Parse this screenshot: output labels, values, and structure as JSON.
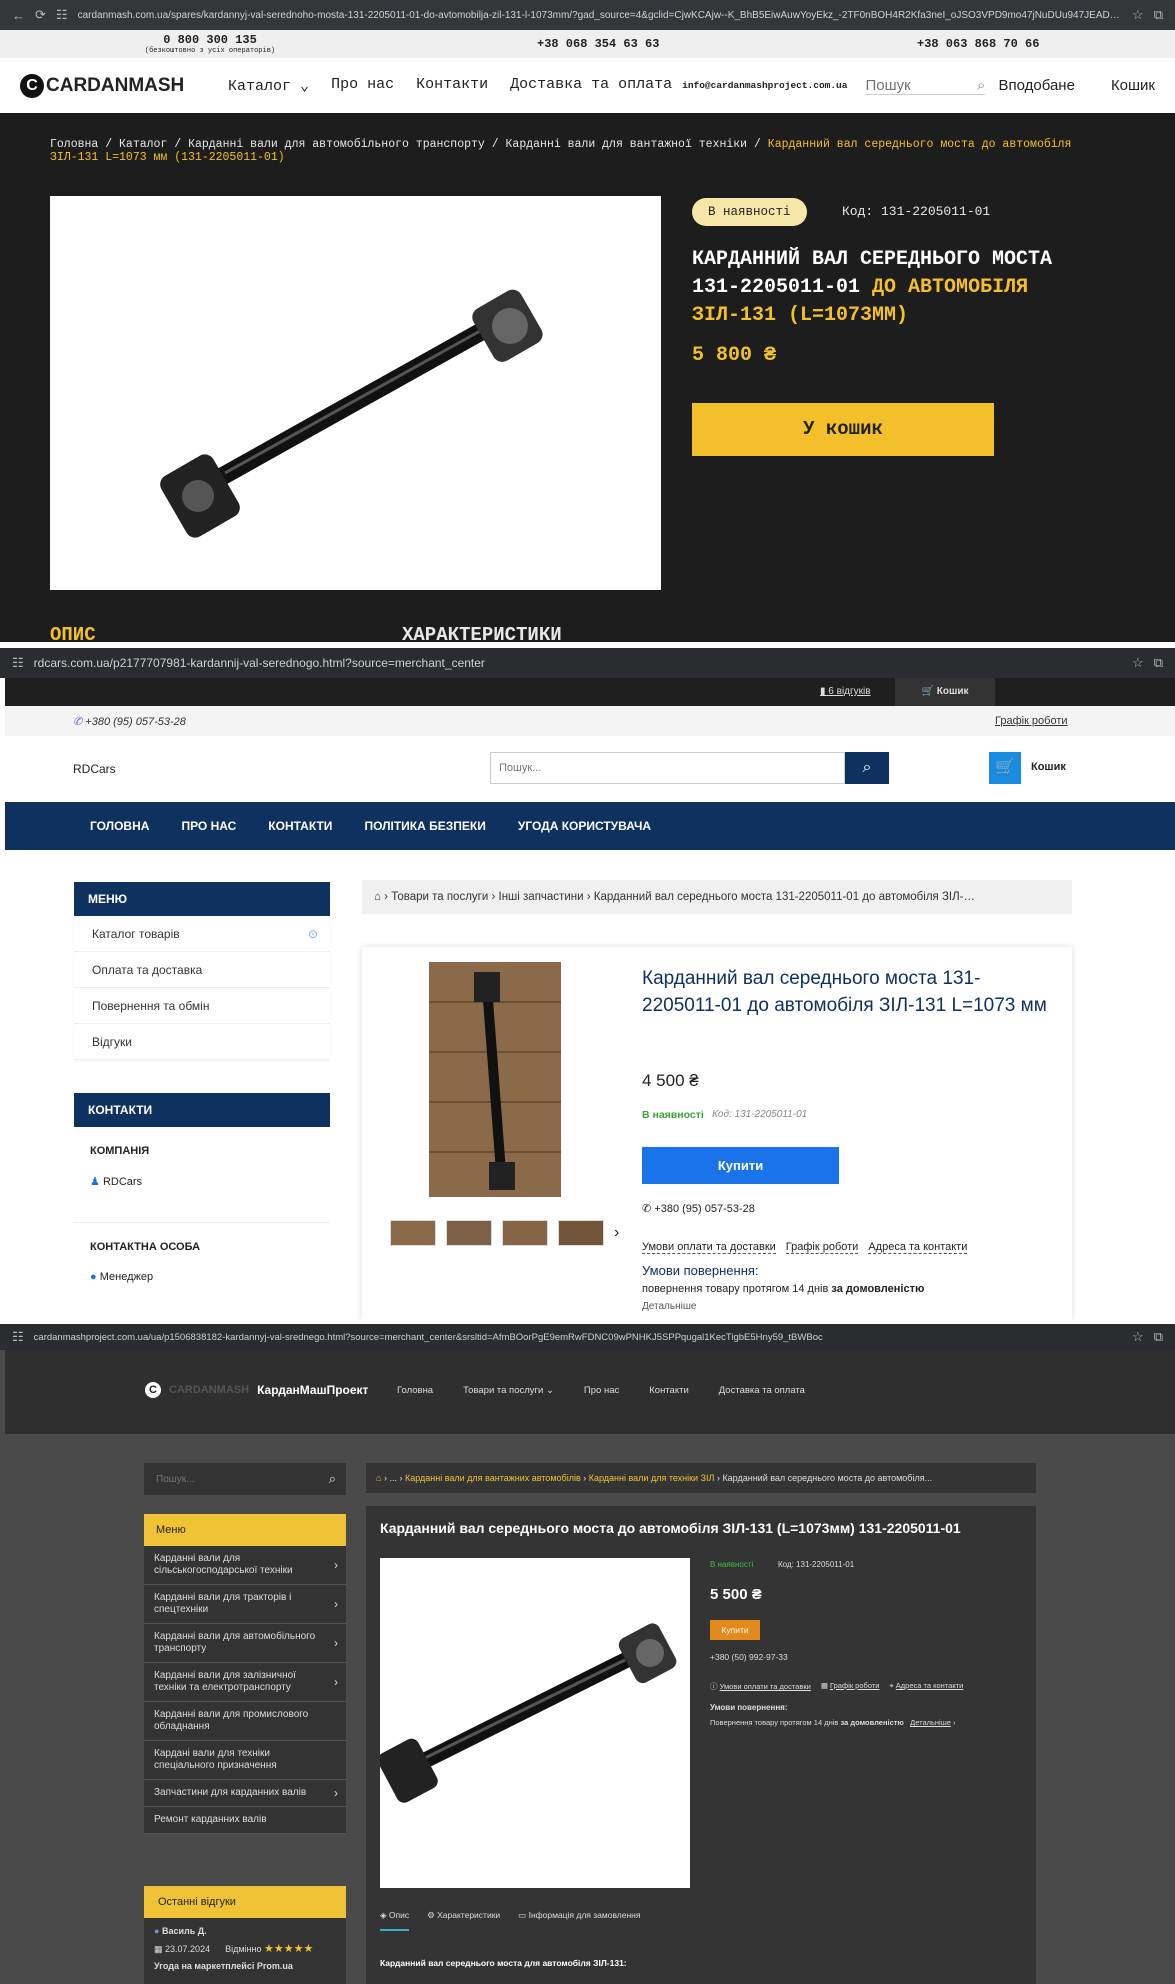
{
  "p1": {
    "url": "cardanmash.com.ua/spares/kardannyj-val-serednoho-mosta-131-2205011-01-do-avtomobilja-zil-131-l-1073mm/?gad_source=4&gclid=CjwKCAjw--K_BhB5EiwAuwYoyEkz_-2TF0nBOH4R2Kfa3neI_oJSO3VPD9mo47jNuDUu947JEAD3hoCzGIQAvD_BwE",
    "hotline": "0 800 300 135",
    "hotline_note": "(безкоштовно з усіх операторів)",
    "phone1": "+38 068 354 63 63",
    "phone2": "+38 063 868 70 66",
    "logo": "CARDANMASH",
    "nav": [
      "Каталог",
      "Про нас",
      "Контакти",
      "Доставка та оплата"
    ],
    "email": "info@cardanmashproject.com.ua",
    "search_placeholder": "Пошук",
    "favorites": "Вподобане",
    "cart": "Кошик",
    "breadcrumb": [
      "Головна",
      "Каталог",
      "Карданні вали для автомобільного транспорту",
      "Карданні вали для вантажної техніки"
    ],
    "breadcrumb_current": "Карданний вал середнього моста до автомобіля ЗІЛ-131 L=1073 мм (131-2205011-01)",
    "stock": "В наявності",
    "code": "Код: 131-2205011-01",
    "title_white": "КАРДАННИЙ ВАЛ СЕРЕДНЬОГО МОСТА 131-2205011-01",
    "title_yellow": "ДО АВТОМОБІЛЯ ЗІЛ-131 (L=1073ММ)",
    "price": "5 800 ₴",
    "buy": "У кошик",
    "tab_desc": "ОПИС",
    "tab_specs": "ХАРАКТЕРИСТИКИ"
  },
  "p2": {
    "url": "rdcars.com.ua/p2177707981-kardannij-val-serednogo.html?source=merchant_center",
    "reviews": "6 відгуків",
    "cart_top": "Кошик",
    "phone": "+380 (95) 057-53-28",
    "schedule": "Графік роботи",
    "logo": "RDCars",
    "search_placeholder": "Пошук...",
    "cart": "Кошик",
    "menu": [
      "ГОЛОВНА",
      "ПРО НАС",
      "КОНТАКТИ",
      "ПОЛІТИКА БЕЗПЕКИ",
      "УГОДА КОРИСТУВАЧА"
    ],
    "side_menu_title": "МЕНЮ",
    "side_menu": [
      "Каталог товарів",
      "Оплата та доставка",
      "Повернення та обмін",
      "Відгуки"
    ],
    "contacts_title": "КОНТАКТИ",
    "company_label": "КОМПАНІЯ",
    "company": "RDCars",
    "person_label": "КОНТАКТНА ОСОБА",
    "person": "Менеджер",
    "breadcrumb": "Товари та послуги › Інші запчастини › Карданний вал середнього моста 131-2205011-01 до автомобіля ЗІЛ-…",
    "title": "Карданний вал середнього моста 131-2205011-01 до автомобіля ЗІЛ-131 L=1073 мм",
    "price": "4 500 ₴",
    "stock": "В наявності",
    "code": "Код: 131-2205011-01",
    "buy": "Купити",
    "card_phone": "+380 (95) 057-53-28",
    "links": [
      "Умови оплати та доставки",
      "Графік роботи",
      "Адреса та контакти"
    ],
    "return_title": "Умови повернення:",
    "return_text": "повернення товару протягом 14 днів",
    "return_bold": "за домовленістю",
    "more": "Детальніше"
  },
  "p3": {
    "url": "cardanmashproject.com.ua/ua/p1506838182-kardannyj-val-srednego.html?source=merchant_center&srsltid=AfmBOorPgE9emRwFDNC09wPNHKJ5SPPqugal1KecTigbE5Hny59_tBWBoc",
    "logo_faded": "CARDANMASH",
    "logo": "КарданМашПроект",
    "nav": [
      "Головна",
      "Товари та послуги",
      "Про нас",
      "Контакти",
      "Доставка та оплата"
    ],
    "search_placeholder": "Пошук...",
    "breadcrumb_links": [
      "...",
      "Карданні вали для вантажних автомобілів",
      "Карданні вали для техніки ЗІЛ"
    ],
    "breadcrumb_current": "Карданний вал середнього моста до автомобіля...",
    "menu_title": "Меню",
    "menu": [
      "Карданні вали для сільськогосподарської техніки",
      "Карданні вали для тракторів і спецтехніки",
      "Карданні вали для автомобільного транспорту",
      "Карданні вали для залізничної техніки та електротранспорту",
      "Карданні вали для промислового обладнання",
      "Кардані вали для техніки спеціального призначення",
      "Запчастини для карданних валів",
      "Ремонт карданних валів"
    ],
    "reviews_title": "Останні відгуки",
    "reviewer": "Василь Д.",
    "review_date": "23.07.2024",
    "review_rating": "Відмінно",
    "review_stars": 5,
    "review_text": "Угода на маркетплейсі Prom.ua",
    "title": "Карданний вал середнього моста до автомобіля ЗІЛ-131 (L=1073мм) 131-2205011-01",
    "stock": "В наявності",
    "code": "Код: 131-2205011-01",
    "price": "5 500 ₴",
    "buy": "Купити",
    "phone": "+380 (50) 992-97-33",
    "links": [
      "Умови оплати та доставки",
      "Графік роботи",
      "Адреса та контакти"
    ],
    "return_title": "Умови повернення:",
    "return_text": "Повернення товару протягом 14 днів",
    "return_bold": "за домовленістю",
    "more": "Детальніше",
    "tabs": [
      "Опис",
      "Характеристики",
      "Інформація для замовлення"
    ],
    "desc": "Карданний вал середнього моста для автомобіля ЗІЛ-131:"
  },
  "colors": {
    "yellow": "#f3c02b",
    "navy": "#0e3160",
    "blue": "#1a73e8",
    "green": "#3aa33a",
    "orange": "#e28a1c"
  }
}
